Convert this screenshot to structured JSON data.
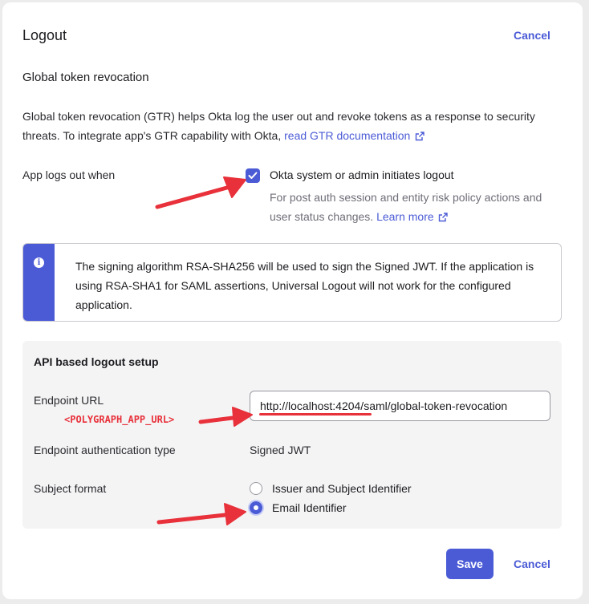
{
  "dialog": {
    "title": "Logout",
    "cancel_top_label": "Cancel"
  },
  "gtr": {
    "section_title": "Global token revocation",
    "description": "Global token revocation (GTR) helps Okta log the user out and revoke tokens as a response to security threats. To integrate app's GTR capability with Okta, ",
    "doc_link": "read GTR documentation",
    "app_logs_out_label": "App logs out when",
    "checkbox_label": "Okta system or admin initiates logout",
    "checkbox_checked": true,
    "checkbox_help": "For post auth session and entity risk policy actions and user status changes. ",
    "learn_more": "Learn more"
  },
  "callout": {
    "text": "The signing algorithm RSA-SHA256 will be used to sign the Signed JWT. If the application is using RSA-SHA1 for SAML assertions, Universal Logout will not work for the configured application."
  },
  "api_setup": {
    "title": "API based logout setup",
    "endpoint_url_label": "Endpoint URL",
    "endpoint_url_value": "http://localhost:4204/saml/global-token-revocation",
    "annotation": "<POLYGRAPH_APP_URL>",
    "auth_type_label": "Endpoint authentication type",
    "auth_type_value": "Signed JWT",
    "subject_format_label": "Subject format",
    "subject_options": [
      {
        "label": "Issuer and Subject Identifier",
        "selected": false
      },
      {
        "label": "Email Identifier",
        "selected": true
      }
    ]
  },
  "footer": {
    "save_label": "Save",
    "cancel_label": "Cancel"
  },
  "colors": {
    "accent": "#4b5bd6",
    "annotation": "#e8313a"
  },
  "icons": [
    "external-link-icon",
    "checkmark-icon",
    "info-icon",
    "red-arrow-icon"
  ]
}
